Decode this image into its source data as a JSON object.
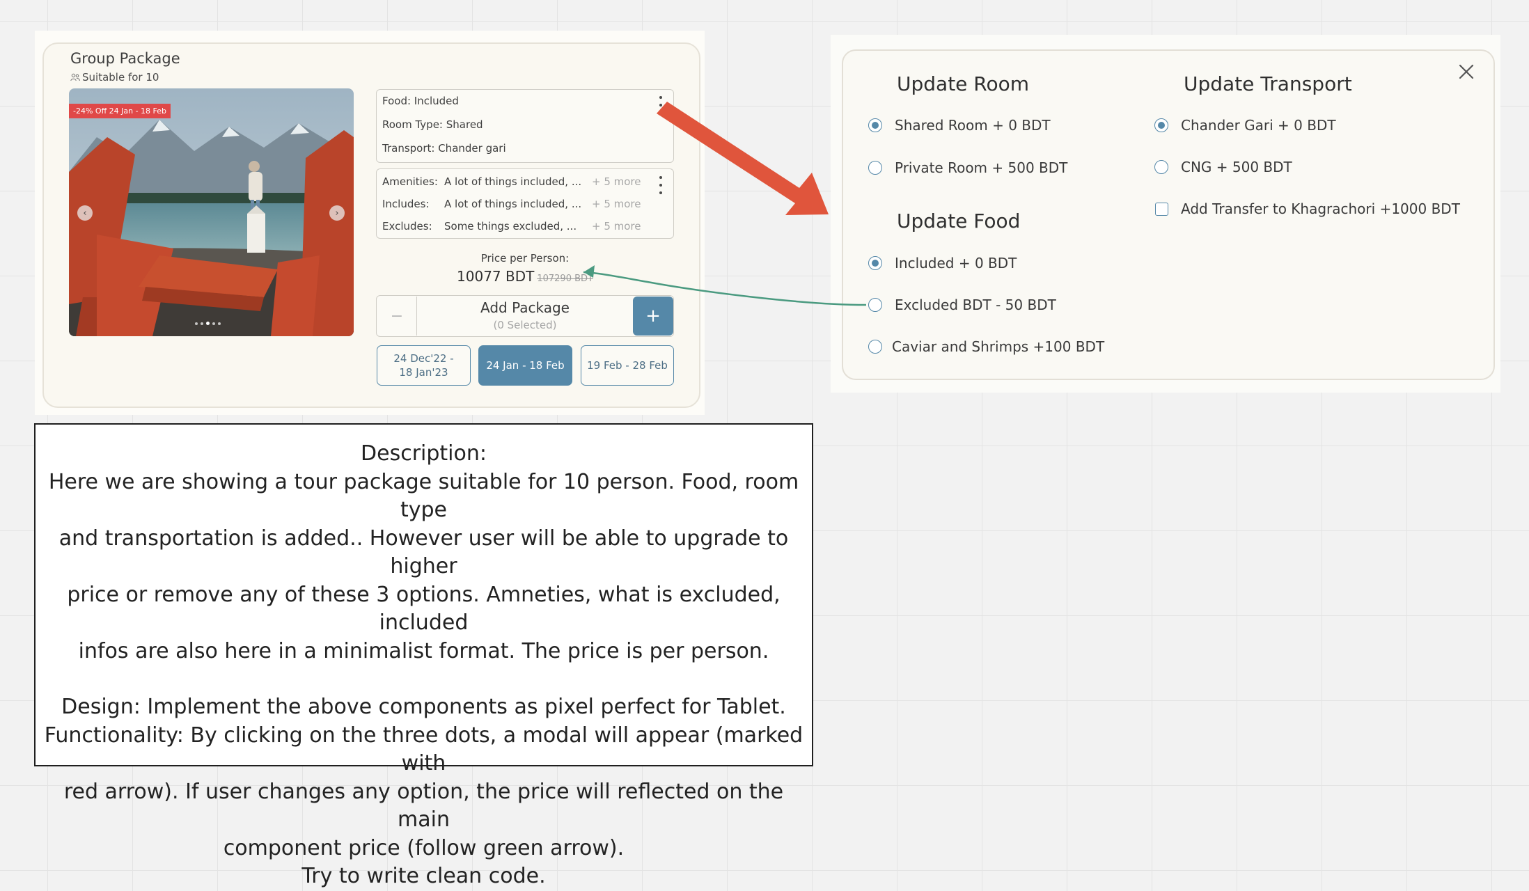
{
  "package": {
    "title": "Group Package",
    "subtitle": "Suitable for 10",
    "discount_badge": "-24% Off 24 Jan - 18 Feb",
    "carousel": {
      "prev_icon": "chevron-left-icon",
      "next_icon": "chevron-right-icon",
      "dot_count": 5,
      "active_dot": 2
    },
    "details": {
      "food": "Food: Included",
      "room": "Room Type: Shared",
      "transport": "Transport: Chander gari"
    },
    "extras": [
      {
        "label": "Amenities:",
        "value": "A lot of things included, ...",
        "more": "+ 5 more"
      },
      {
        "label": "Includes:",
        "value": "A lot of things included, ...",
        "more": "+ 5 more"
      },
      {
        "label": "Excludes:",
        "value": "Some things excluded, ...",
        "more": "+ 5 more"
      }
    ],
    "price_label": "Price per Person:",
    "price_current": "10077 BDT",
    "price_old": "107290 BDT",
    "quantity": {
      "minus": "−",
      "plus": "+",
      "label": "Add Package",
      "sub": "(0 Selected)"
    },
    "dates": [
      {
        "line1": "24 Dec'22 -",
        "line2": "18 Jan'23",
        "active": false
      },
      {
        "line1": "24 Jan - 18 Feb",
        "line2": "",
        "active": true
      },
      {
        "line1": "19 Feb - 28 Feb",
        "line2": "",
        "active": false
      }
    ]
  },
  "modal": {
    "close_icon": "close-icon",
    "room": {
      "heading": "Update Room",
      "options": [
        {
          "label": "Shared Room + 0 BDT",
          "checked": true
        },
        {
          "label": "Private Room + 500 BDT",
          "checked": false
        }
      ]
    },
    "food": {
      "heading": "Update Food",
      "options": [
        {
          "label": "Included + 0 BDT",
          "checked": true
        },
        {
          "label": "Excluded BDT - 50 BDT",
          "checked": false
        },
        {
          "label": "Caviar and Shrimps +100 BDT",
          "checked": false
        }
      ]
    },
    "transport": {
      "heading": "Update Transport",
      "options": [
        {
          "label": "Chander Gari + 0 BDT",
          "checked": true
        },
        {
          "label": "CNG + 500 BDT",
          "checked": false
        }
      ],
      "checkbox": {
        "label": "Add Transfer to Khagrachori +1000 BDT",
        "checked": false
      }
    }
  },
  "annotations": {
    "red_arrow_color": "#e0553c",
    "green_arrow_color": "#4a9a80"
  },
  "description": {
    "lines": [
      "Description:",
      "Here we are showing a tour package suitable for 10 person. Food, room type",
      "and transportation is added.. However user will be able to upgrade to higher",
      "price or remove any of these 3 options. Amneties, what is excluded, included",
      "infos are also here in a minimalist format. The price is per person.",
      "",
      "Design: Implement the above components as pixel perfect for Tablet.",
      "Functionality: By clicking on the three dots, a modal will appear (marked with",
      "red arrow). If user changes any option, the price will reflected on the main",
      "component price (follow green arrow).",
      "Try to write clean code."
    ]
  },
  "colors": {
    "accent": "#5588a8",
    "badge": "#e04848",
    "canvas": "#f2f2f2"
  }
}
